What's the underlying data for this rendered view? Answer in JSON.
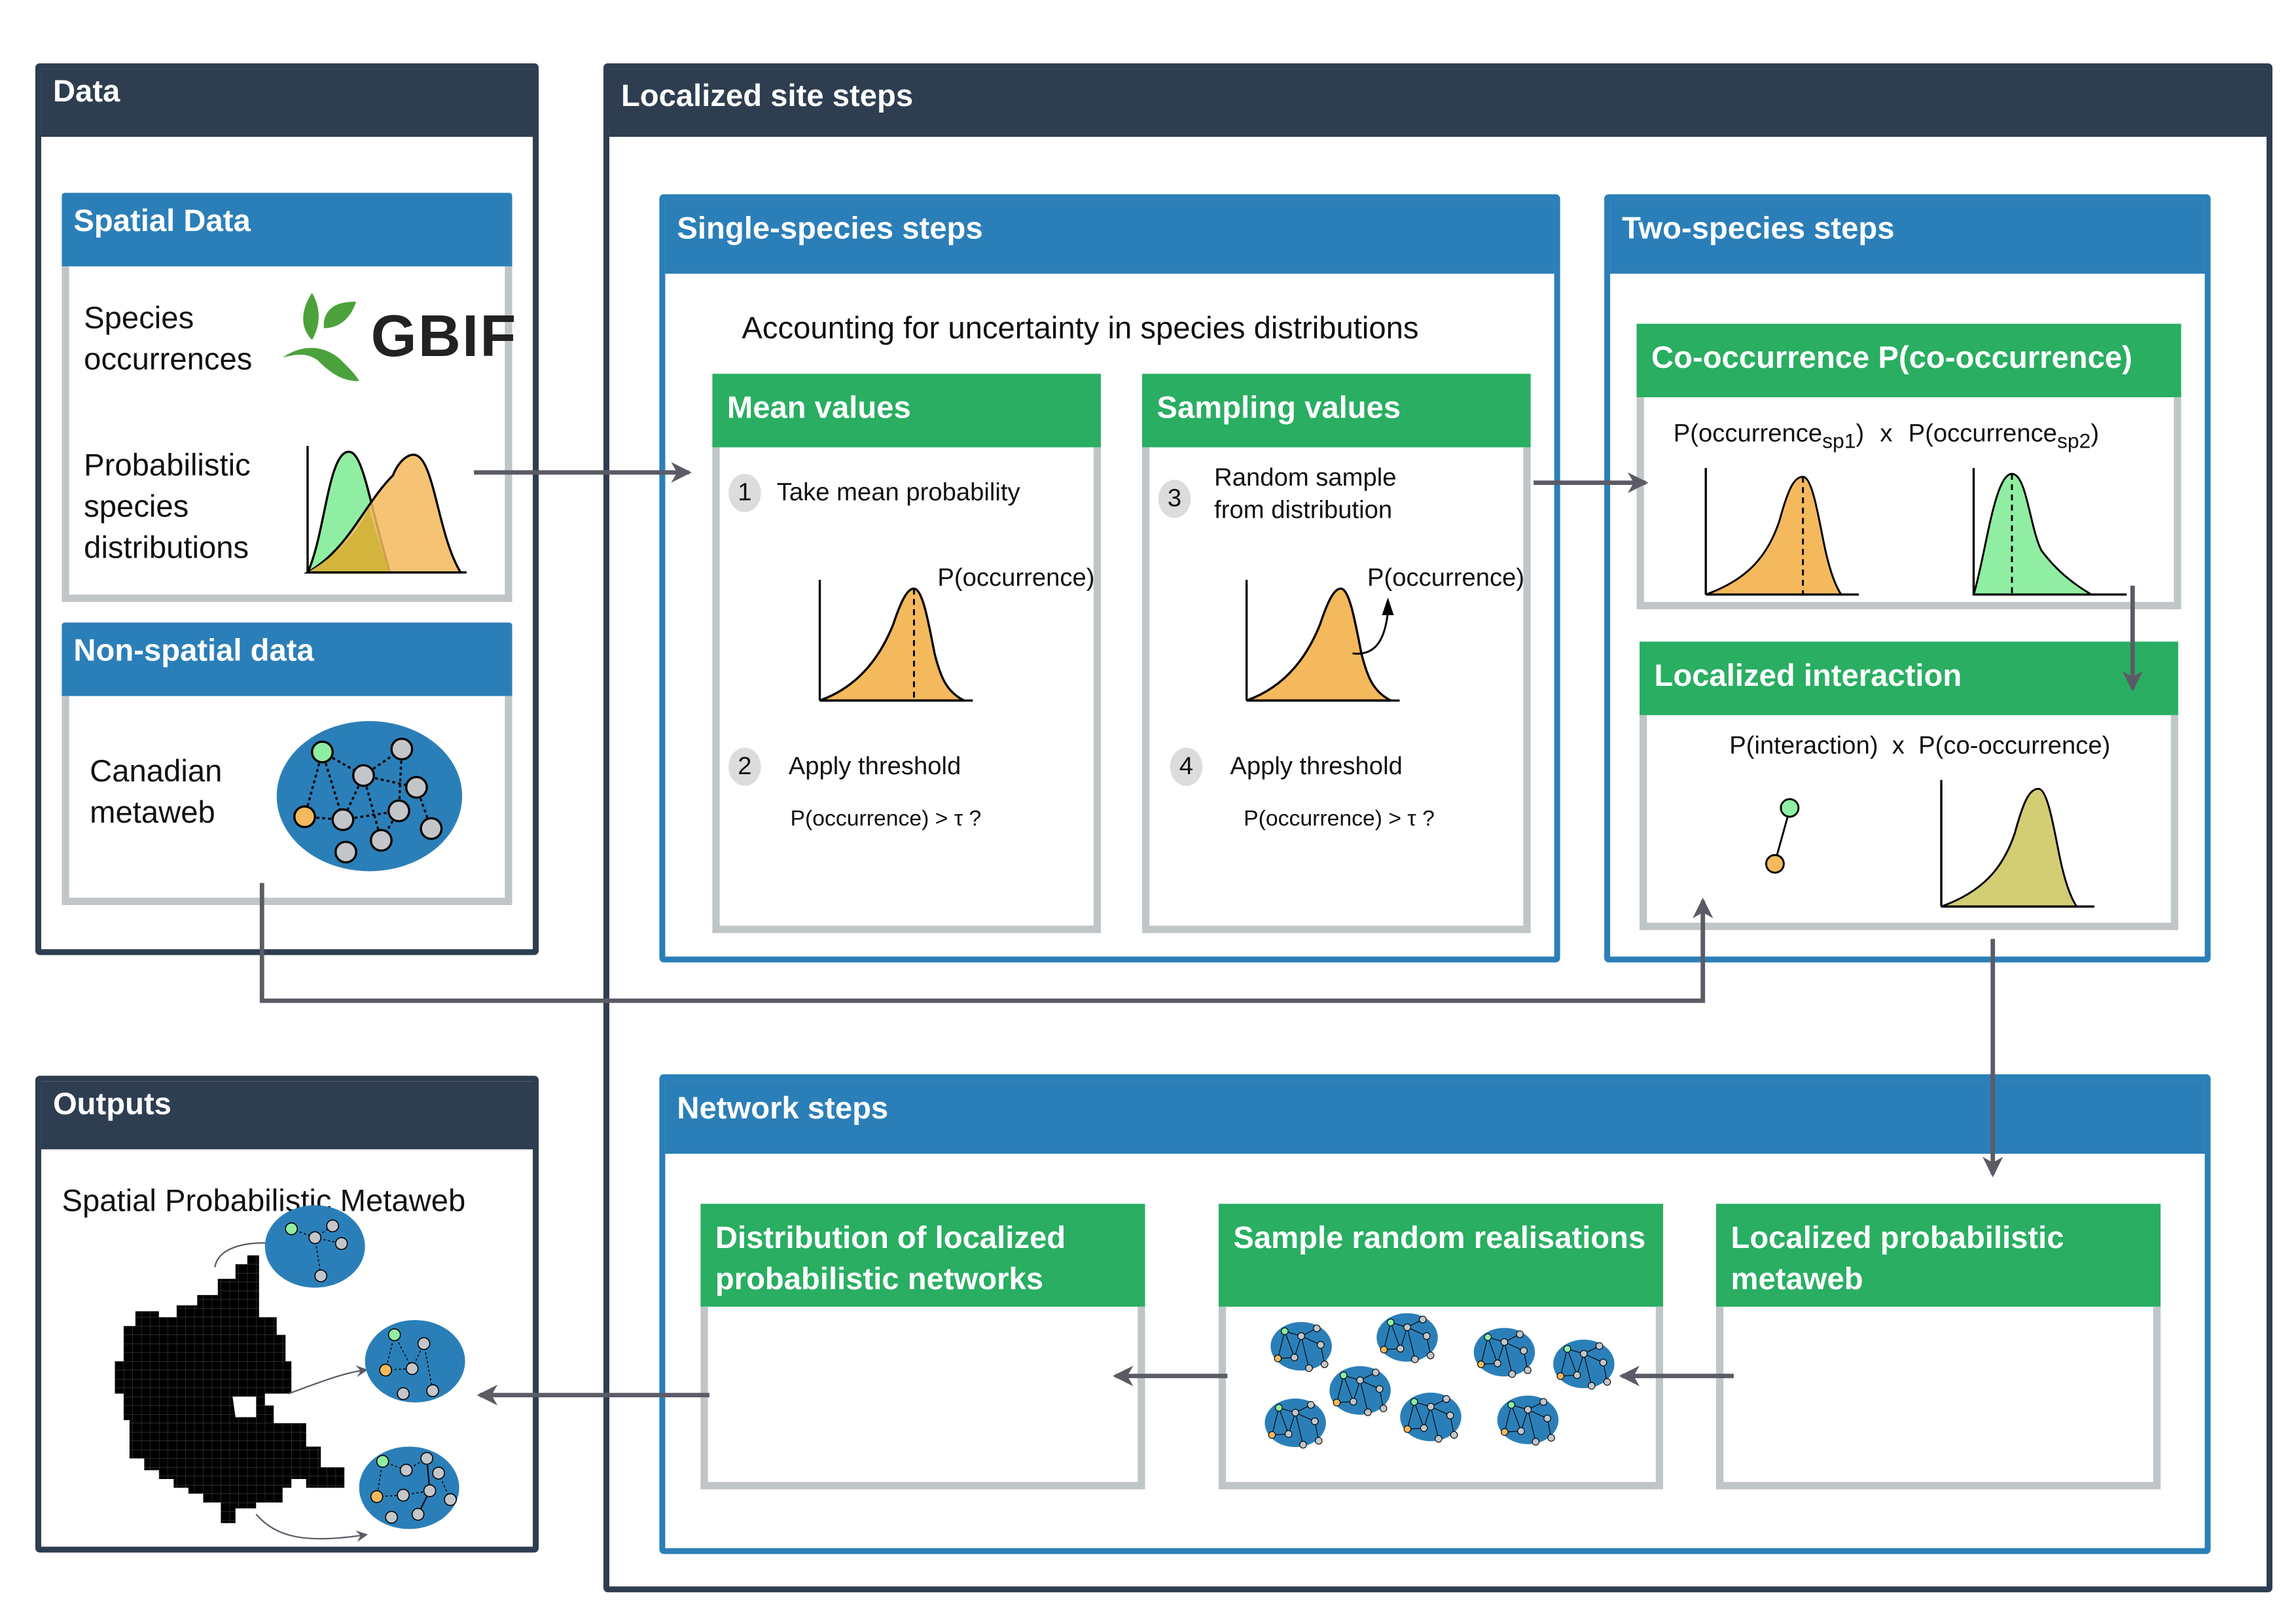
{
  "data_panel": {
    "title": "Data",
    "spatial": {
      "title": "Spatial Data",
      "species_occurrences": "Species occurrences",
      "gbif_logo_text": "GBIF",
      "probabilistic_distributions": "Probabilistic species distributions"
    },
    "non_spatial": {
      "title": "Non-spatial data",
      "metaweb": "Canadian metaweb"
    }
  },
  "localized_panel": {
    "title": "Localized site steps",
    "single_species": {
      "title": "Single-species steps",
      "subtitle": "Accounting for uncertainty in species distributions",
      "mean_values": {
        "title": "Mean values",
        "step1_num": "1",
        "step1_label": "Take mean probability",
        "curve_label": "P(occurrence)",
        "step2_num": "2",
        "step2_label": "Apply threshold",
        "threshold_expr": "P(occurrence) > τ ?"
      },
      "sampling_values": {
        "title": "Sampling values",
        "step3_num": "3",
        "step3_label_line1": "Random sample",
        "step3_label_line2": "from distribution",
        "curve_label": "P(occurrence)",
        "step4_num": "4",
        "step4_label": "Apply threshold",
        "threshold_expr": "P(occurrence) > τ ?"
      }
    },
    "two_species": {
      "title": "Two-species steps",
      "cooccurrence": {
        "title": "Co-occurrence P(co-occurrence)",
        "term1_main": "P(occurrence",
        "term1_sub": "sp1",
        "term1_close": ")",
        "times": "x",
        "term2_main": "P(occurrence",
        "term2_sub": "sp2",
        "term2_close": ")"
      },
      "localized_interaction": {
        "title": "Localized interaction",
        "formula": "P(interaction)  x  P(co-occurrence)"
      }
    },
    "network_steps": {
      "title": "Network steps",
      "distribution": "Distribution of localized probabilistic networks",
      "sample_random": "Sample random realisations",
      "localized_metaweb": "Localized probabilistic metaweb"
    }
  },
  "outputs_panel": {
    "title": "Outputs",
    "label": "Spatial Probabilistic Metaweb"
  },
  "colors": {
    "dark_navy": "#2e3e50",
    "blue": "#2b7fb8",
    "green": "#29ae62",
    "orange_curve": "#f4b95c",
    "green_curve": "#90eea2",
    "olive_curve": "#d3cd74",
    "node_grey": "#c4c6c9",
    "arrow_grey": "#5b5b66"
  }
}
